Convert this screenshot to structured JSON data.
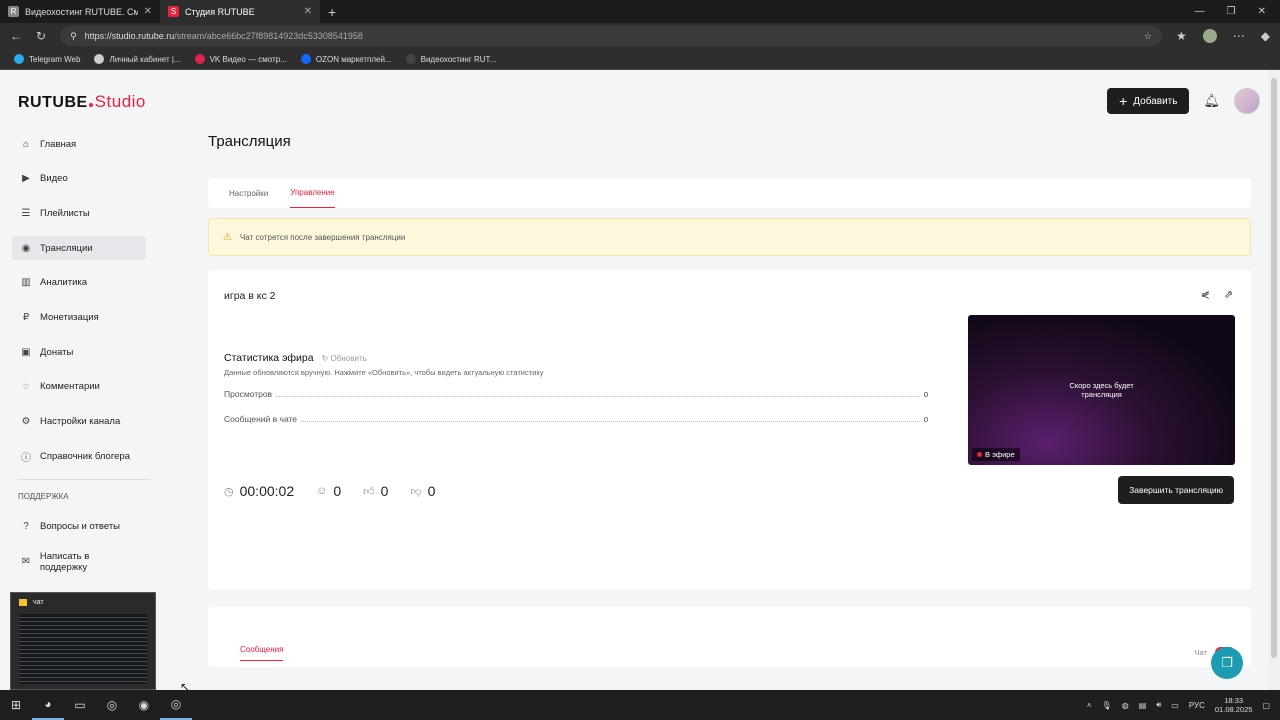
{
  "browser": {
    "tabs": [
      {
        "title": "Видеохостинг RUTUBE. Смотрите",
        "favicon": "R",
        "active": false
      },
      {
        "title": "Студия RUTUBE",
        "favicon": "S",
        "active": true
      }
    ],
    "url_host": "https://studio.rutube.ru",
    "url_path": "/stream/abce66bc27f89814923dc53308541958",
    "bookmarks": [
      {
        "label": "Telegram Web",
        "color": "#2aabee"
      },
      {
        "label": "Личный кабинет |...",
        "color": "#cccccc"
      },
      {
        "label": "VK Видео — смотр...",
        "color": "#e02252"
      },
      {
        "label": "OZON маркетплей...",
        "color": "#1467ff"
      },
      {
        "label": "Видеохостинг RUT...",
        "color": "#444444"
      }
    ]
  },
  "header": {
    "logo_main": "RUTUBE",
    "logo_studio": "Studio",
    "add_button": "Добавить"
  },
  "sidebar": {
    "items": [
      {
        "label": "Главная",
        "icon": "home-icon",
        "glyph": "⌂",
        "active": false
      },
      {
        "label": "Видео",
        "icon": "video-icon",
        "glyph": "▶",
        "active": false
      },
      {
        "label": "Плейлисты",
        "icon": "playlist-icon",
        "glyph": "☰",
        "active": false
      },
      {
        "label": "Трансляции",
        "icon": "broadcast-icon",
        "glyph": "◉",
        "active": true
      },
      {
        "label": "Аналитика",
        "icon": "analytics-icon",
        "glyph": "▥",
        "active": false
      },
      {
        "label": "Монетизация",
        "icon": "money-icon",
        "glyph": "₽",
        "active": false
      },
      {
        "label": "Донаты",
        "icon": "donate-icon",
        "glyph": "▣",
        "active": false
      },
      {
        "label": "Комментарии",
        "icon": "comments-icon",
        "glyph": "◌",
        "active": false
      },
      {
        "label": "Настройки канала",
        "icon": "settings-icon",
        "glyph": "⚙",
        "active": false
      },
      {
        "label": "Справочник блогера",
        "icon": "guide-icon",
        "glyph": "ⓘ",
        "active": false
      }
    ],
    "support_title": "ПОДДЕРЖКА",
    "support_items": [
      {
        "label": "Вопросы и ответы",
        "icon": "faq-icon",
        "glyph": "?"
      },
      {
        "label": "Написать в поддержку",
        "icon": "mail-icon",
        "glyph": "✉"
      }
    ]
  },
  "thumbnail": {
    "title": "чат"
  },
  "main": {
    "title": "Трансляция",
    "tabs": [
      {
        "label": "Настройки",
        "active": false
      },
      {
        "label": "Управление",
        "active": true
      }
    ],
    "warning": "Чат сотрется после завершения трансляции",
    "stream_name": "игра в кс 2",
    "stats_title": "Статистика эфира",
    "refresh_label": "Обновить",
    "stats_hint": "Данные обновляются вручную. Нажмите «Обновить», чтобы видеть актуальную статистику",
    "stats": [
      {
        "label": "Просмотров",
        "value": "0"
      },
      {
        "label": "Сообщений в чате",
        "value": "0"
      }
    ],
    "duration": "00:00:02",
    "viewers": "0",
    "likes": "0",
    "dislikes": "0",
    "preview_text": "Скоро здесь будет трансляция",
    "live_badge": "В эфире",
    "finish_button": "Завершить трансляцию",
    "chat_tab": "Сообщения",
    "chat_toggle_label": "Чат",
    "chat_enabled": true
  },
  "taskbar": {
    "lang": "РУС",
    "time": "18:33",
    "date": "01.08.2025"
  },
  "colors": {
    "accent": "#e8223f",
    "dark": "#1e1e1e",
    "warning_bg": "#fdf8dc"
  }
}
